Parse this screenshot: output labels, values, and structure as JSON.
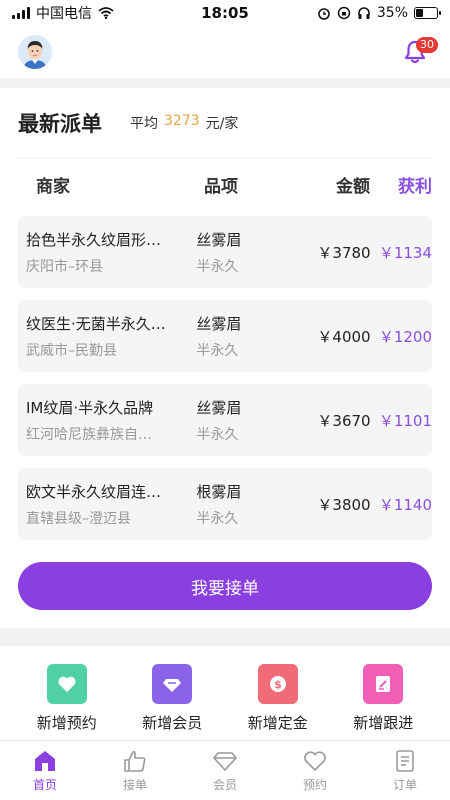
{
  "status_bar": {
    "carrier": "中国电信",
    "time": "18:05",
    "battery": "35%"
  },
  "header": {
    "notification_count": "30"
  },
  "dispatch": {
    "title": "最新派单",
    "avg_label": "平均",
    "avg_value": "3273",
    "avg_unit": "元/家",
    "columns": {
      "merchant": "商家",
      "item": "品项",
      "amount": "金额",
      "profit": "获利"
    },
    "rows": [
      {
        "name": "拾色半永久纹眉形…",
        "location": "庆阳市–环县",
        "item": "丝雾眉",
        "category": "半永久",
        "amount": "￥3780",
        "profit": "￥1134"
      },
      {
        "name": "纹医生·无菌半永久…",
        "location": "武威市–民勤县",
        "item": "丝雾眉",
        "category": "半永久",
        "amount": "￥4000",
        "profit": "￥1200"
      },
      {
        "name": "IM纹眉·半永久品牌",
        "location": "红河哈尼族彝族自…",
        "item": "丝雾眉",
        "category": "半永久",
        "amount": "￥3670",
        "profit": "￥1101"
      },
      {
        "name": "欧文半永久纹眉连…",
        "location": "直辖县级–澄迈县",
        "item": "根雾眉",
        "category": "半永久",
        "amount": "￥3800",
        "profit": "￥1140"
      }
    ],
    "accept_button": "我要接单"
  },
  "quick_actions": [
    {
      "label": "新增预约",
      "icon": "heart-icon",
      "color": "#4fd1a5"
    },
    {
      "label": "新增会员",
      "icon": "diamond-icon",
      "color": "#8a63e8"
    },
    {
      "label": "新增定金",
      "icon": "dollar-coin-icon",
      "color": "#f06b78"
    },
    {
      "label": "新增跟进",
      "icon": "edit-note-icon",
      "color": "#f25fb7"
    }
  ],
  "tabs": [
    {
      "label": "首页",
      "icon": "home-icon",
      "active": true
    },
    {
      "label": "接单",
      "icon": "thumbs-up-icon",
      "active": false
    },
    {
      "label": "会员",
      "icon": "diamond-icon",
      "active": false
    },
    {
      "label": "预约",
      "icon": "heart-icon",
      "active": false
    },
    {
      "label": "订单",
      "icon": "document-icon",
      "active": false
    }
  ],
  "colors": {
    "accent": "#8a3fe0",
    "avg_highlight": "#e6a64a",
    "profit": "#8a4fe0"
  }
}
